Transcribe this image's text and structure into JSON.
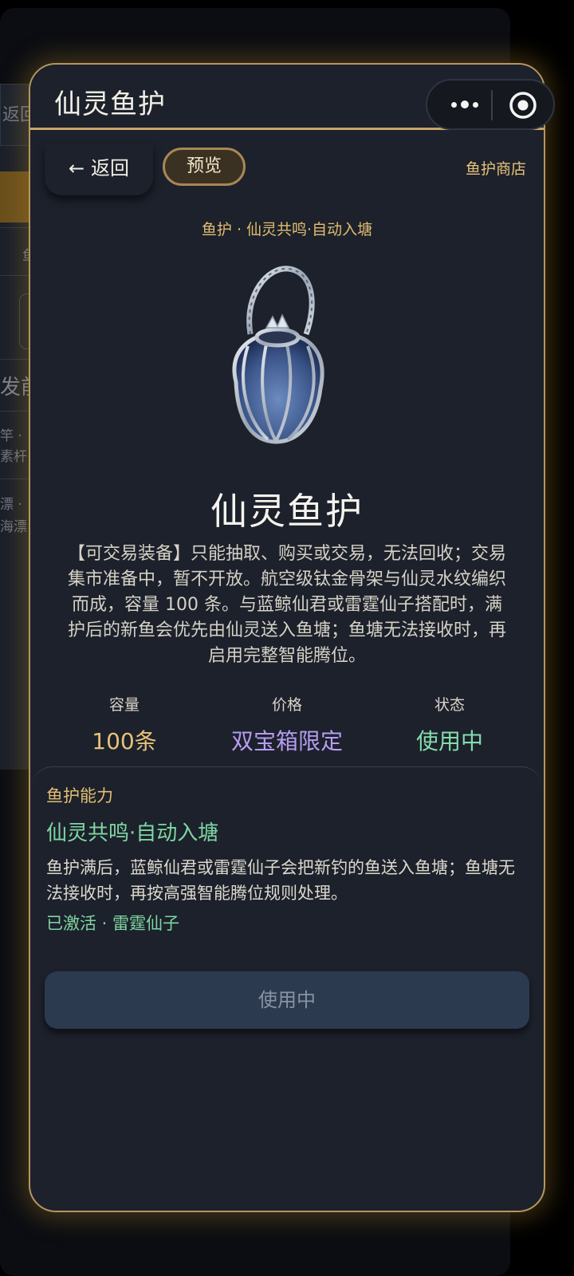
{
  "background": {
    "back_label": "返回",
    "fragment_1": "鱼",
    "fragment_2": "发前",
    "fragment_3": "竿 ·",
    "fragment_4": "素杆",
    "fragment_5": "漂 ·",
    "fragment_6": "海漂"
  },
  "header": {
    "title": "仙灵鱼护",
    "more_icon": "more-dots-icon",
    "target_icon": "target-icon"
  },
  "nav": {
    "back_label": "返回",
    "preview_label": "预览",
    "shop_link": "鱼护商店"
  },
  "item": {
    "subtitle": "鱼护 · 仙灵共鸣·自动入塘",
    "name": "仙灵鱼护",
    "description": "【可交易装备】只能抽取、购买或交易，无法回收；交易集市准备中，暂不开放。航空级钛金骨架与仙灵水纹编织而成，容量 100 条。与蓝鲸仙君或雷霆仙子搭配时，满护后的新鱼会优先由仙灵送入鱼塘；鱼塘无法接收时，再启用完整智能腾位。"
  },
  "stats": [
    {
      "label": "容量",
      "value": "100条",
      "color": "#e7c17a"
    },
    {
      "label": "价格",
      "value": "双宝箱限定",
      "color": "#b79cf0"
    },
    {
      "label": "状态",
      "value": "使用中",
      "color": "#84dcab"
    }
  ],
  "ability": {
    "heading": "鱼护能力",
    "name": "仙灵共鸣·自动入塘",
    "description": "鱼护满后，蓝鲸仙君或雷霆仙子会把新钓的鱼送入鱼塘；鱼塘无法接收时，再按高强智能腾位规则处理。",
    "status": "已激活 · 雷霆仙子"
  },
  "action": {
    "button_label": "使用中"
  },
  "colors": {
    "accent_gold": "#c9a56a",
    "panel": "#1c212b",
    "green": "#7fd6a2",
    "purple": "#b79cf0"
  }
}
